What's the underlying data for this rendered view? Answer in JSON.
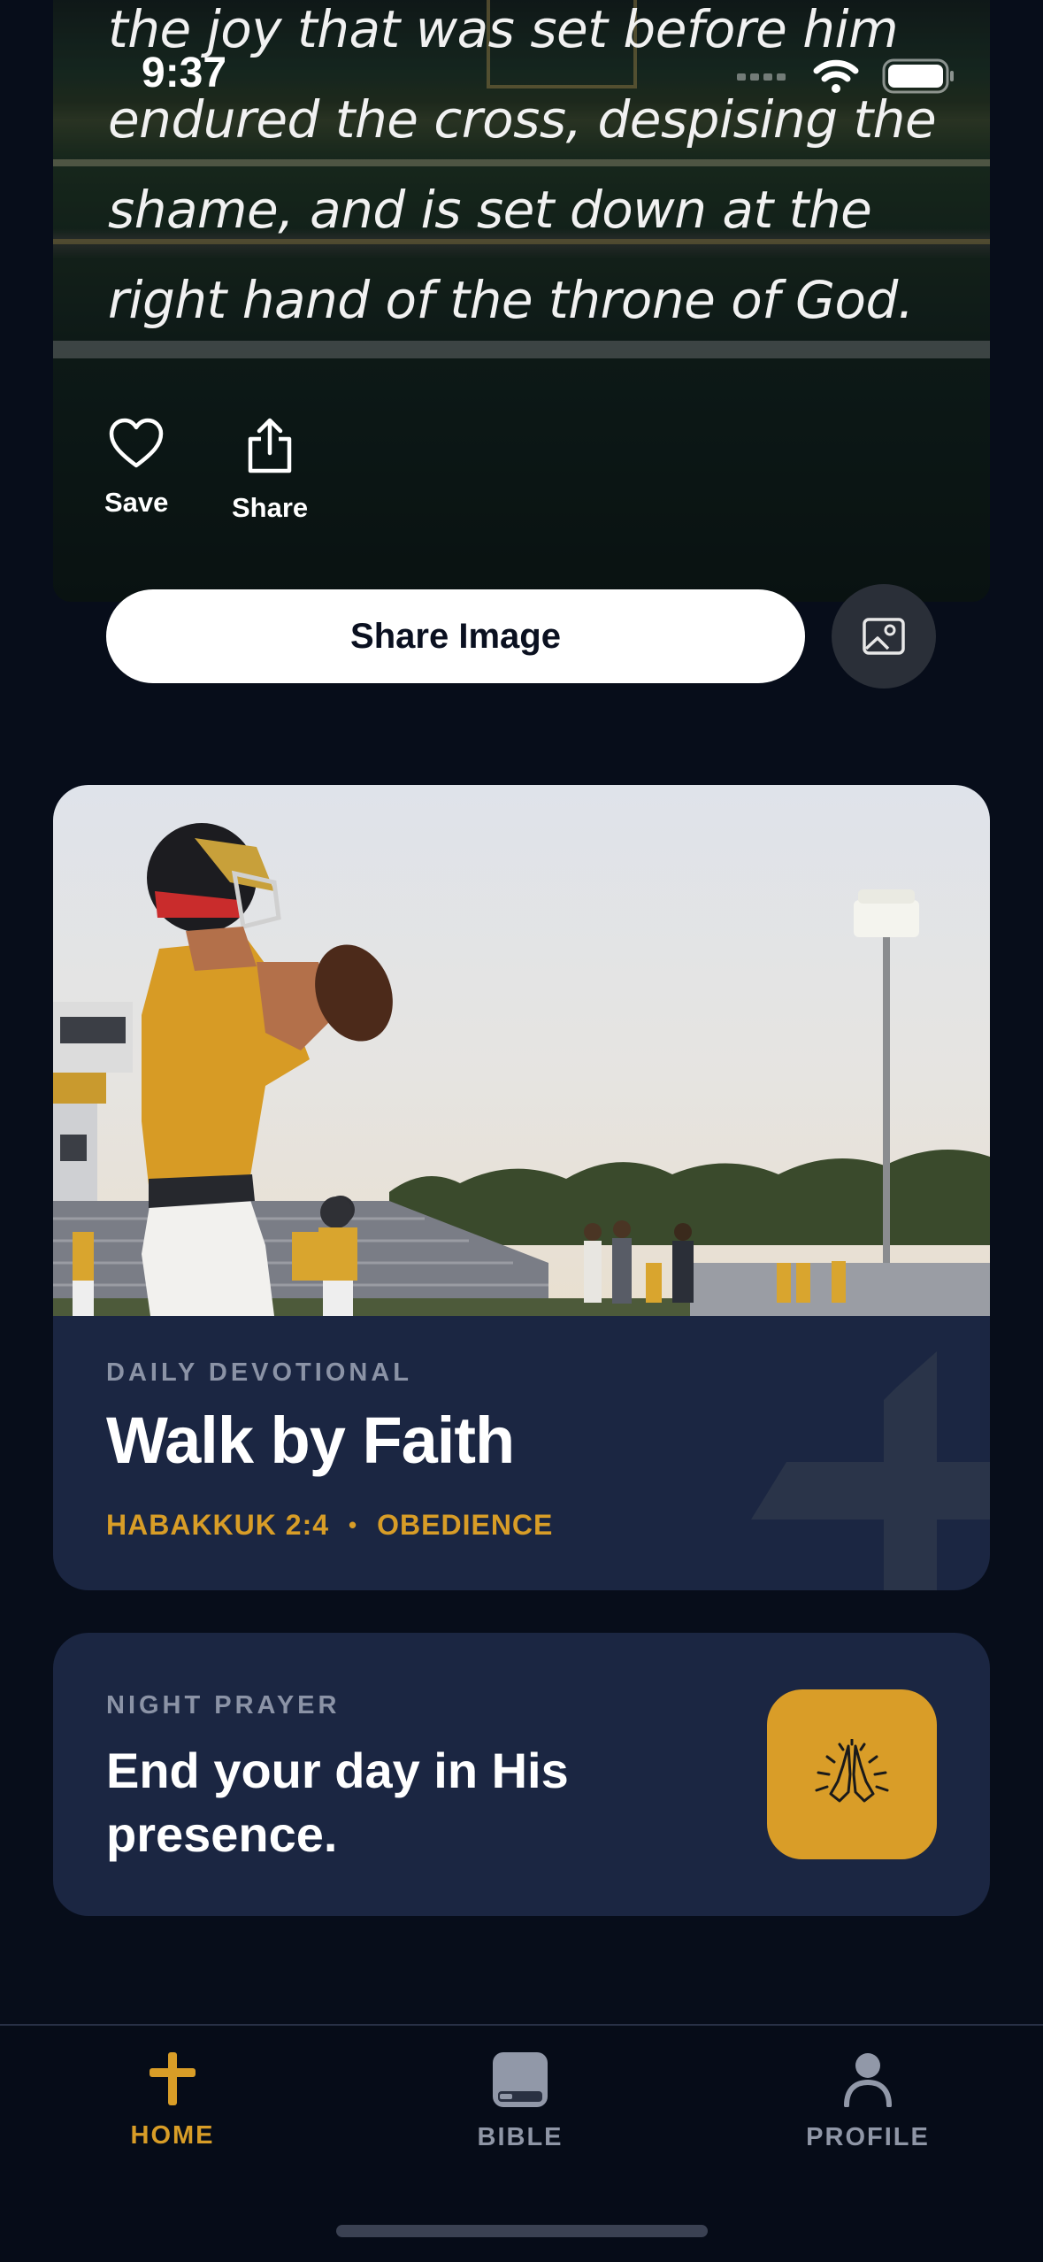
{
  "status_bar": {
    "time": "9:37"
  },
  "verse": {
    "lines": [
      "the joy that was set before him",
      "endured the cross, despising the",
      "shame, and is set down at the",
      "right hand of the throne of God."
    ]
  },
  "actions": {
    "save_label": "Save",
    "share_label": "Share",
    "share_image_label": "Share Image"
  },
  "devotional": {
    "kicker": "DAILY DEVOTIONAL",
    "title": "Walk by Faith",
    "reference": "HABAKKUK 2:4",
    "separator": "•",
    "topic": "OBEDIENCE"
  },
  "night_prayer": {
    "kicker": "NIGHT PRAYER",
    "title": "End your day in His presence."
  },
  "tabs": [
    {
      "label": "HOME",
      "icon": "cross-icon",
      "active": true
    },
    {
      "label": "BIBLE",
      "icon": "book-icon",
      "active": false
    },
    {
      "label": "PROFILE",
      "icon": "person-icon",
      "active": false
    }
  ],
  "colors": {
    "accent": "#d89d27",
    "background": "#070d1a",
    "card": "#1b2642"
  }
}
